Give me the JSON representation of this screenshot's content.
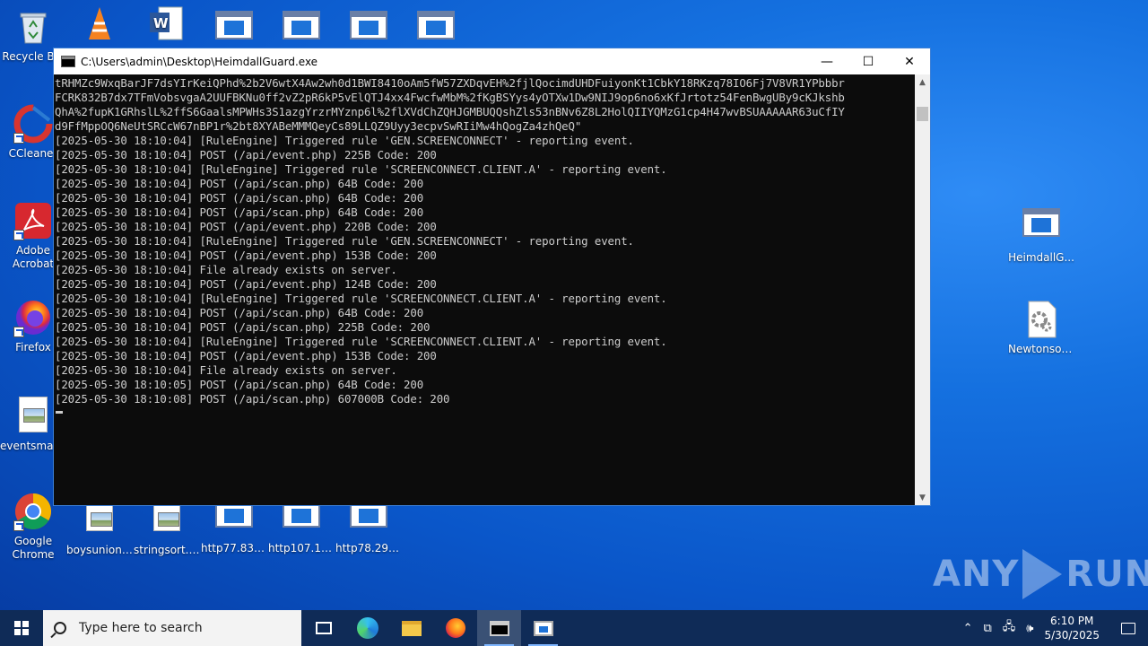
{
  "desktop": {
    "icons": [
      {
        "label": "Recycle Bin",
        "icon": "recycle-bin-icon"
      },
      {
        "label": "CCleaner",
        "icon": "ccleaner-icon"
      },
      {
        "label": "Adobe Acrobat",
        "icon": "adobe-acrobat-icon"
      },
      {
        "label": "Firefox",
        "icon": "firefox-icon"
      },
      {
        "label": "eventsmanager",
        "icon": "image-file-icon"
      },
      {
        "label": "Google Chrome",
        "icon": "chrome-icon"
      },
      {
        "label": "boysunion....",
        "icon": "image-file-icon"
      },
      {
        "label": "stringsort.jpg",
        "icon": "image-file-icon"
      },
      {
        "label": "http77.83.2...",
        "icon": "exe-icon"
      },
      {
        "label": "http107.175...",
        "icon": "exe-icon"
      },
      {
        "label": "http78.29.4...",
        "icon": "exe-icon"
      },
      {
        "label": "HeimdallG...",
        "icon": "exe-icon"
      },
      {
        "label": "Newtonsof...",
        "icon": "settings-file-icon"
      }
    ]
  },
  "window": {
    "title": "C:\\Users\\admin\\Desktop\\HeimdallGuard.exe",
    "minimize": "—",
    "maximize": "☐",
    "close": "✕",
    "lines": [
      "tRHMZc9WxqBarJF7dsYIrKeiQPhd%2b2V6wtX4Aw2wh0d1BWI8410oAm5fW57ZXDqvEH%2fjlQocimdUHDFuiyonKt1CbkY18RKzq78IO6Fj7V8VR1YPbbbr",
      "FCRK832B7dx7TFmVobsvgaA2UUFBKNu0ff2vZ2pR6kP5vElQTJ4xx4FwcfwMbM%2fKgBSYys4yOTXw1Dw9NIJ9op6no6xKfJrtotz54FenBwgUBy9cKJkshb",
      "QhA%2fupK1GRhslL%2ffS6GaalsMPWHs3S1azgYrzrMYznp6l%2flXVdChZQHJGMBUQQshZls53nBNv6Z8L2HolQIIYQMzG1cp4H47wvBSUAAAAAR63uCfIY",
      "d9FfMppOQ6NeUtSRCcW67nBP1r%2bt8XYABeMMMQeyCs89LLQZ9Uyy3ecpvSwRIiMw4hQogZa4zhQeQ\"",
      "[2025-05-30 18:10:04] [RuleEngine] Triggered rule 'GEN.SCREENCONNECT' - reporting event.",
      "[2025-05-30 18:10:04] POST (/api/event.php) 225B Code: 200",
      "[2025-05-30 18:10:04] [RuleEngine] Triggered rule 'SCREENCONNECT.CLIENT.A' - reporting event.",
      "[2025-05-30 18:10:04] POST (/api/scan.php) 64B Code: 200",
      "[2025-05-30 18:10:04] POST (/api/scan.php) 64B Code: 200",
      "[2025-05-30 18:10:04] POST (/api/scan.php) 64B Code: 200",
      "[2025-05-30 18:10:04] POST (/api/event.php) 220B Code: 200",
      "[2025-05-30 18:10:04] [RuleEngine] Triggered rule 'GEN.SCREENCONNECT' - reporting event.",
      "[2025-05-30 18:10:04] POST (/api/event.php) 153B Code: 200",
      "[2025-05-30 18:10:04] File already exists on server.",
      "[2025-05-30 18:10:04] POST (/api/event.php) 124B Code: 200",
      "[2025-05-30 18:10:04] [RuleEngine] Triggered rule 'SCREENCONNECT.CLIENT.A' - reporting event.",
      "[2025-05-30 18:10:04] POST (/api/scan.php) 64B Code: 200",
      "[2025-05-30 18:10:04] POST (/api/scan.php) 225B Code: 200",
      "[2025-05-30 18:10:04] [RuleEngine] Triggered rule 'SCREENCONNECT.CLIENT.A' - reporting event.",
      "[2025-05-30 18:10:04] POST (/api/event.php) 153B Code: 200",
      "[2025-05-30 18:10:04] File already exists on server.",
      "[2025-05-30 18:10:05] POST (/api/scan.php) 64B Code: 200",
      "[2025-05-30 18:10:08] POST (/api/scan.php) 607000B Code: 200"
    ]
  },
  "watermark": {
    "left": "ANY",
    "right": "RUN"
  },
  "taskbar": {
    "search_placeholder": "Type here to search",
    "items": [
      {
        "name": "task-view",
        "icon": "task-view-icon"
      },
      {
        "name": "edge",
        "icon": "edge-icon"
      },
      {
        "name": "file-explorer",
        "icon": "folder-icon"
      },
      {
        "name": "firefox",
        "icon": "firefox-icon"
      },
      {
        "name": "console",
        "icon": "console-icon"
      },
      {
        "name": "heimdallguard",
        "icon": "app-icon"
      }
    ],
    "time": "6:10 PM",
    "date": "5/30/2025"
  }
}
